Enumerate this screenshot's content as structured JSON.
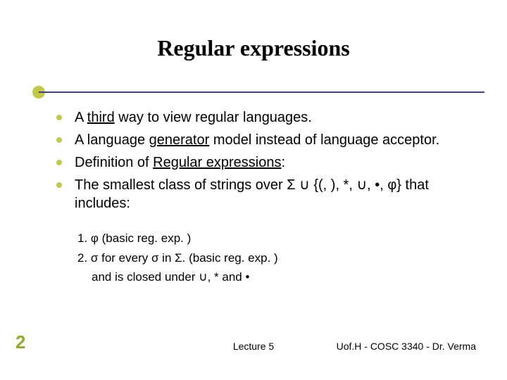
{
  "title": "Regular expressions",
  "bullets": [
    {
      "pre": "A ",
      "emph": "third",
      "post": " way to view regular languages."
    },
    {
      "pre": "A language ",
      "emph": "generator",
      "post": " model instead of language acceptor."
    },
    {
      "pre": "Definition of ",
      "emph": "Regular expressions",
      "post": ":"
    },
    {
      "pre": "The smallest class of strings over Σ ∪ {(, ), *, ∪, •, φ} that includes:",
      "emph": "",
      "post": ""
    }
  ],
  "subitems": {
    "line1": "1. φ (basic reg. exp. )",
    "line2": "2. σ for every σ in Σ. (basic reg. exp. )",
    "line3": "and is closed under ∪, * and •"
  },
  "page_number": "2",
  "footer_center": "Lecture 5",
  "footer_right": "Uof.H - COSC 3340 - Dr. Verma"
}
